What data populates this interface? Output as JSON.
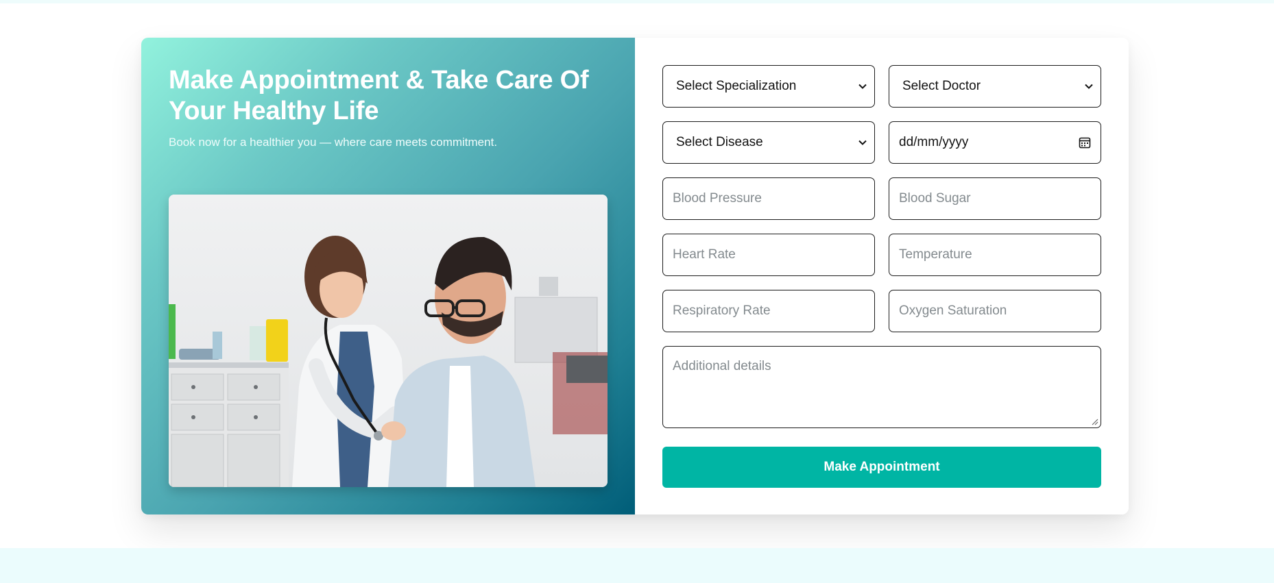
{
  "hero": {
    "title": "Make Appointment & Take Care Of Your Healthy Life",
    "subtitle": "Book now for a healthier you — where care meets commitment.",
    "photo_description": "doctor-with-stethoscope-examining-patient-photo"
  },
  "form": {
    "specialization": {
      "selected": "Select Specialization"
    },
    "doctor": {
      "selected": "Select Doctor"
    },
    "disease": {
      "selected": "Select Disease"
    },
    "date": {
      "value": "dd/mm/yyyy"
    },
    "blood_pressure": {
      "placeholder": "Blood Pressure"
    },
    "blood_sugar": {
      "placeholder": "Blood Sugar"
    },
    "heart_rate": {
      "placeholder": "Heart Rate"
    },
    "temperature": {
      "placeholder": "Temperature"
    },
    "respiratory_rate": {
      "placeholder": "Respiratory Rate"
    },
    "oxygen_saturation": {
      "placeholder": "Oxygen Saturation"
    },
    "additional_details": {
      "placeholder": "Additional details"
    },
    "submit_label": "Make Appointment"
  },
  "colors": {
    "accent": "#00b5a4",
    "gradient_start": "#92f2dd",
    "gradient_end": "#005d78",
    "page_band": "#ebfcfd"
  },
  "icons": {
    "select": "chevron-down-icon",
    "date": "calendar-icon",
    "textarea": "resize-handle-icon"
  }
}
